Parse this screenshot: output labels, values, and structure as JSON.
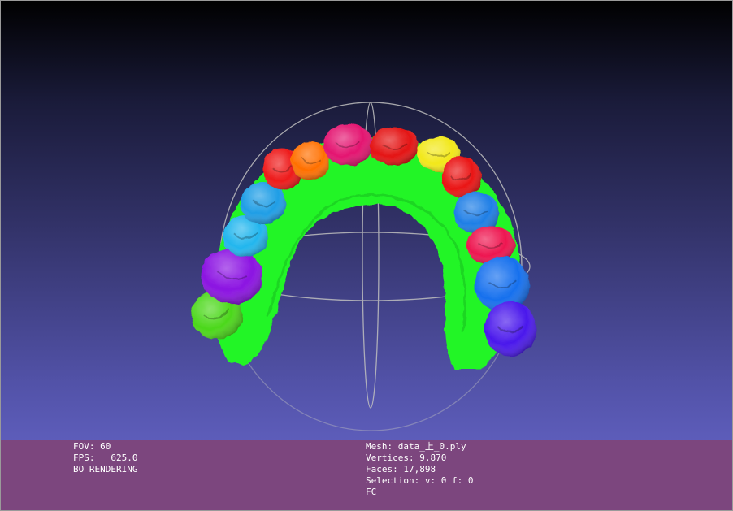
{
  "viewer": {
    "background_top": "#000000",
    "background_bottom": "#6b6ad0",
    "info_bar_color": "#7c467e"
  },
  "scene": {
    "objects": [
      "trackball-sphere",
      "gum-mesh",
      "teeth"
    ],
    "teeth_colors": [
      "#4bd81a",
      "#8b12e2",
      "#22b6ee",
      "#1f9ee6",
      "#ee1a1a",
      "#ff7000",
      "#e41470",
      "#e41414",
      "#f2e81a",
      "#ea1414",
      "#1e7ee6",
      "#ee1650",
      "#1670ee",
      "#4a18ec"
    ],
    "gum_color": "#22f528",
    "trackball_color": "#bfbfbf"
  },
  "info_left": {
    "fov": "FOV: 60",
    "fps": "FPS:   625.0",
    "mode": "BO_RENDERING"
  },
  "info_right": {
    "mesh": "Mesh: data_上_0.ply",
    "vertices": "Vertices: 9,870",
    "faces": "Faces: 17,898",
    "selection": "Selection: v: 0 f: 0",
    "extra": "FC"
  }
}
